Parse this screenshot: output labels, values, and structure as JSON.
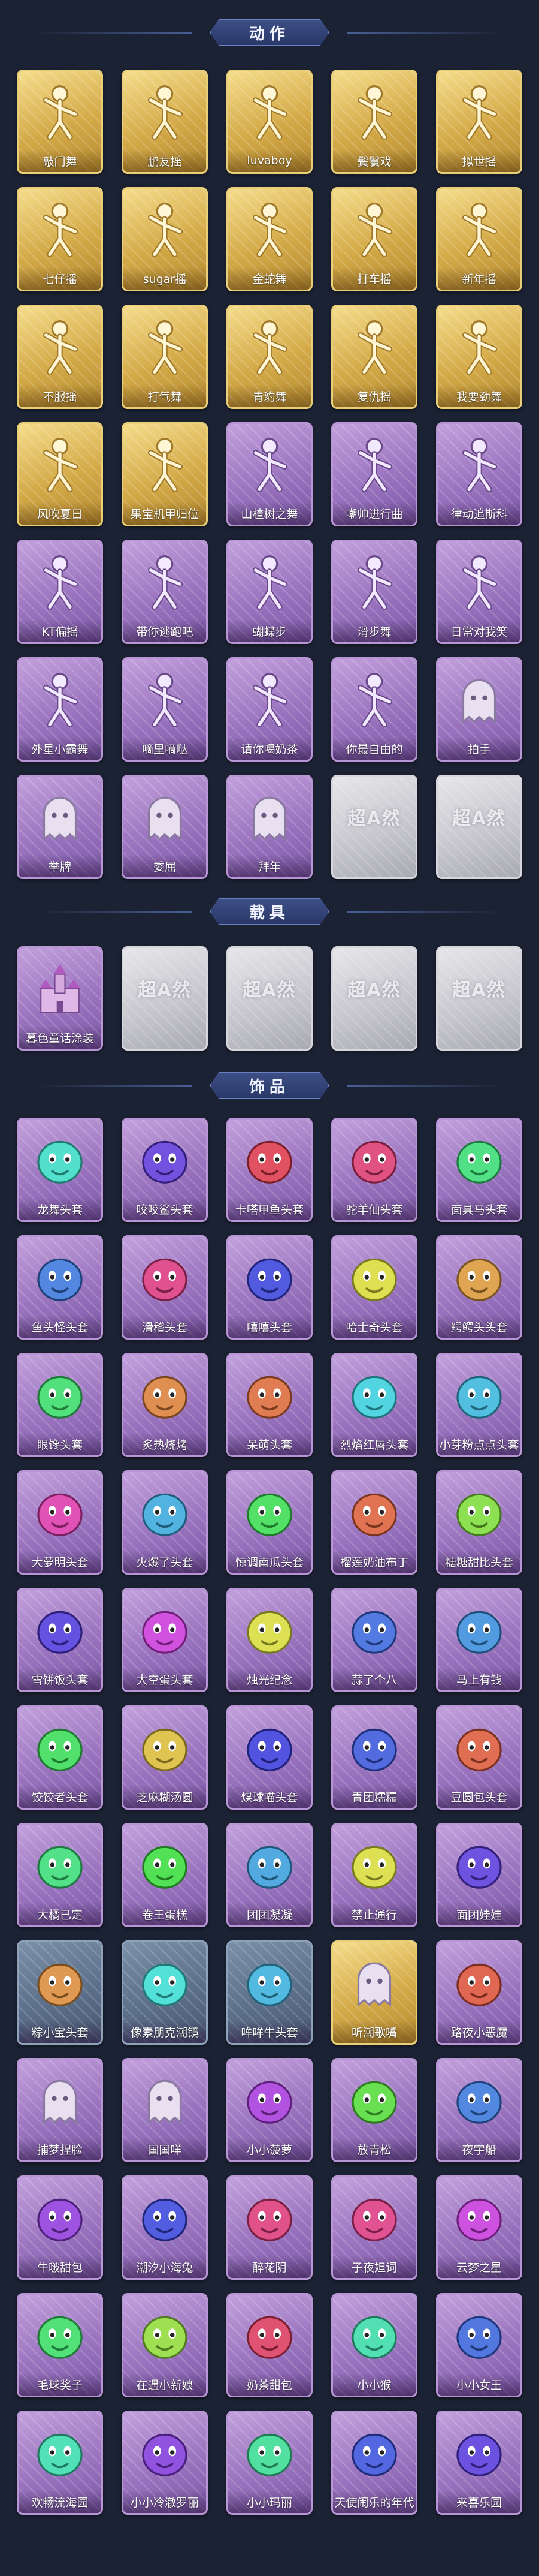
{
  "sections": [
    {
      "id": "actions",
      "title": "动作",
      "items": [
        {
          "label": "敲门舞",
          "style": "gold",
          "icon": "dance-pose-icon"
        },
        {
          "label": "鹏友摇",
          "style": "gold",
          "icon": "dance-pose-icon"
        },
        {
          "label": "luvaboy",
          "style": "gold",
          "icon": "dance-pose-icon"
        },
        {
          "label": "鬓鬟戏",
          "style": "gold",
          "icon": "dance-pose-icon"
        },
        {
          "label": "拟世摇",
          "style": "gold",
          "icon": "dance-pose-icon"
        },
        {
          "label": "七仔摇",
          "style": "gold",
          "icon": "dance-pose-icon"
        },
        {
          "label": "sugar摇",
          "style": "gold",
          "icon": "dance-pose-icon"
        },
        {
          "label": "金蛇舞",
          "style": "gold",
          "icon": "dance-pose-icon"
        },
        {
          "label": "打车摇",
          "style": "gold",
          "icon": "dance-pose-icon"
        },
        {
          "label": "新年摇",
          "style": "gold",
          "icon": "dance-pose-icon"
        },
        {
          "label": "不服摇",
          "style": "gold",
          "icon": "dance-pose-icon"
        },
        {
          "label": "打气舞",
          "style": "gold",
          "icon": "dance-pose-icon"
        },
        {
          "label": "青豹舞",
          "style": "gold",
          "icon": "dance-pose-icon"
        },
        {
          "label": "复仇摇",
          "style": "gold",
          "icon": "dance-pose-icon"
        },
        {
          "label": "我要劲舞",
          "style": "gold",
          "icon": "dance-pose-icon"
        },
        {
          "label": "风吹夏日",
          "style": "gold",
          "icon": "dance-pose-icon"
        },
        {
          "label": "果宝机甲归位",
          "style": "gold",
          "icon": "dance-pose-icon"
        },
        {
          "label": "山楂树之舞",
          "style": "purple",
          "icon": "dance-pose-icon"
        },
        {
          "label": "嘲帅进行曲",
          "style": "purple",
          "icon": "dance-pose-icon"
        },
        {
          "label": "律动追斯科",
          "style": "purple",
          "icon": "dance-pose-icon"
        },
        {
          "label": "KT偏摇",
          "style": "purple",
          "icon": "dance-pose-icon"
        },
        {
          "label": "带你逃跑吧",
          "style": "purple",
          "icon": "dance-pose-icon"
        },
        {
          "label": "蝴蝶步",
          "style": "purple",
          "icon": "dance-pose-icon"
        },
        {
          "label": "滑步舞",
          "style": "purple",
          "icon": "dance-pose-icon"
        },
        {
          "label": "日常对我笑",
          "style": "purple",
          "icon": "dance-pose-icon"
        },
        {
          "label": "外星小霸舞",
          "style": "purple",
          "icon": "dance-pose-icon"
        },
        {
          "label": "嘀里嘀哒",
          "style": "purple",
          "icon": "dance-pose-icon"
        },
        {
          "label": "请你喝奶茶",
          "style": "purple",
          "icon": "dance-pose-icon"
        },
        {
          "label": "你最自由的",
          "style": "purple",
          "icon": "dance-pose-icon"
        },
        {
          "label": "拍手",
          "style": "purple",
          "icon": "ghost-pose-icon"
        },
        {
          "label": "举牌",
          "style": "purple",
          "icon": "ghost-pose-icon"
        },
        {
          "label": "委屈",
          "style": "purple",
          "icon": "ghost-pose-icon"
        },
        {
          "label": "拜年",
          "style": "purple",
          "icon": "ghost-pose-icon"
        },
        {
          "label": "超A然",
          "style": "silver",
          "icon": "brand-placeholder-icon"
        },
        {
          "label": "超A然",
          "style": "silver",
          "icon": "brand-placeholder-icon"
        }
      ]
    },
    {
      "id": "vehicles",
      "title": "载具",
      "items": [
        {
          "label": "暮色童话涂装",
          "style": "purple",
          "icon": "castle-icon"
        },
        {
          "label": "超A然",
          "style": "silver",
          "icon": "brand-placeholder-icon"
        },
        {
          "label": "超A然",
          "style": "silver",
          "icon": "brand-placeholder-icon"
        },
        {
          "label": "超A然",
          "style": "silver",
          "icon": "brand-placeholder-icon"
        },
        {
          "label": "超A然",
          "style": "silver",
          "icon": "brand-placeholder-icon"
        }
      ]
    },
    {
      "id": "accessories",
      "title": "饰品",
      "items": [
        {
          "label": "龙舞头套",
          "style": "purple",
          "icon": "dragon-head-icon"
        },
        {
          "label": "咬咬鲨头套",
          "style": "purple",
          "icon": "shark-head-icon"
        },
        {
          "label": "卡嗒甲鱼头套",
          "style": "purple",
          "icon": "fish-head-icon"
        },
        {
          "label": "驼羊仙头套",
          "style": "purple",
          "icon": "sheep-head-icon"
        },
        {
          "label": "面具马头套",
          "style": "purple",
          "icon": "horse-head-icon"
        },
        {
          "label": "鱼头怪头套",
          "style": "purple",
          "icon": "fish-monster-icon"
        },
        {
          "label": "滑稽头套",
          "style": "purple",
          "icon": "funny-face-icon"
        },
        {
          "label": "嘻嘻头套",
          "style": "purple",
          "icon": "grin-face-icon"
        },
        {
          "label": "哈士奇头套",
          "style": "purple",
          "icon": "dog-head-icon"
        },
        {
          "label": "鳄鳄头头套",
          "style": "purple",
          "icon": "crocodile-head-icon"
        },
        {
          "label": "眼馋头套",
          "style": "purple",
          "icon": "drool-face-icon"
        },
        {
          "label": "炙热烧烤",
          "style": "purple",
          "icon": "bbq-head-icon"
        },
        {
          "label": "呆萌头套",
          "style": "purple",
          "icon": "dumb-face-icon"
        },
        {
          "label": "烈焰红唇头套",
          "style": "purple",
          "icon": "cool-pikachu-icon"
        },
        {
          "label": "小芽粉点点头套",
          "style": "purple",
          "icon": "pink-blob-icon"
        },
        {
          "label": "大萝明头套",
          "style": "purple",
          "icon": "bokchoy-head-icon"
        },
        {
          "label": "火爆了头套",
          "style": "purple",
          "icon": "fire-head-icon"
        },
        {
          "label": "惊调南瓜头套",
          "style": "purple",
          "icon": "pumpkin-head-icon"
        },
        {
          "label": "榴莲奶油布丁",
          "style": "purple",
          "icon": "pudding-head-icon"
        },
        {
          "label": "糖糖甜比头套",
          "style": "purple",
          "icon": "pink-bunny-icon"
        },
        {
          "label": "雪饼饭头套",
          "style": "purple",
          "icon": "snowman-head-icon"
        },
        {
          "label": "大空蛋头套",
          "style": "purple",
          "icon": "egg-head-icon"
        },
        {
          "label": "烛光纪念",
          "style": "purple",
          "icon": "candle-head-icon"
        },
        {
          "label": "蒜了个八",
          "style": "purple",
          "icon": "garlic-head-icon"
        },
        {
          "label": "马上有钱",
          "style": "purple",
          "icon": "money-head-icon"
        },
        {
          "label": "饺饺者头套",
          "style": "purple",
          "icon": "dumpling-head-icon"
        },
        {
          "label": "芝麻糊汤圆",
          "style": "purple",
          "icon": "tangyuan-head-icon"
        },
        {
          "label": "煤球喵头套",
          "style": "purple",
          "icon": "cat-head-icon"
        },
        {
          "label": "青团糯糯",
          "style": "purple",
          "icon": "green-bun-icon"
        },
        {
          "label": "豆圆包头套",
          "style": "purple",
          "icon": "bun-head-icon"
        },
        {
          "label": "大橘已定",
          "style": "purple",
          "icon": "orange-head-icon"
        },
        {
          "label": "卷王蛋糕",
          "style": "purple",
          "icon": "cake-head-icon"
        },
        {
          "label": "团团凝凝",
          "style": "purple",
          "icon": "hamster-head-icon"
        },
        {
          "label": "禁止通行",
          "style": "purple",
          "icon": "roadblock-head-icon"
        },
        {
          "label": "面团娃娃",
          "style": "purple",
          "icon": "dough-head-icon"
        },
        {
          "label": "粽小宝头套",
          "style": "blue",
          "icon": "zongzi-head-icon"
        },
        {
          "label": "像素朋克潮镜",
          "style": "blue",
          "icon": "pixel-sunglasses-icon"
        },
        {
          "label": "哞哞牛头套",
          "style": "blue",
          "icon": "cow-head-icon"
        },
        {
          "label": "听潮歌嘴",
          "style": "gold",
          "icon": "ghost-head-icon"
        },
        {
          "label": "路夜小恶魔",
          "style": "purple",
          "icon": "devil-head-icon"
        },
        {
          "label": "捕梦捏脸",
          "style": "purple",
          "icon": "ghost-head-icon"
        },
        {
          "label": "国国咩",
          "style": "purple",
          "icon": "ghost-head-icon"
        },
        {
          "label": "小小菠萝",
          "style": "purple",
          "icon": "pineapple-doll-icon"
        },
        {
          "label": "放青松",
          "style": "purple",
          "icon": "pine-doll-icon"
        },
        {
          "label": "夜宇船",
          "style": "purple",
          "icon": "crystal-tree-icon"
        },
        {
          "label": "牛啵甜包",
          "style": "purple",
          "icon": "cow-bag-icon"
        },
        {
          "label": "潮汐小海兔",
          "style": "purple",
          "icon": "blue-bunny-icon"
        },
        {
          "label": "醉花阴",
          "style": "purple",
          "icon": "flower-doll-icon"
        },
        {
          "label": "子夜妲词",
          "style": "purple",
          "icon": "dancer-doll-icon"
        },
        {
          "label": "云梦之星",
          "style": "purple",
          "icon": "cloud-star-icon"
        },
        {
          "label": "毛球奖子",
          "style": "purple",
          "icon": "soldier-doll-icon"
        },
        {
          "label": "在遇小新娘",
          "style": "purple",
          "icon": "red-bride-icon"
        },
        {
          "label": "奶茶甜包",
          "style": "purple",
          "icon": "tea-bag-icon"
        },
        {
          "label": "小小猴",
          "style": "purple",
          "icon": "monkey-doll-icon"
        },
        {
          "label": "小小女王",
          "style": "purple",
          "icon": "queen-doll-icon"
        },
        {
          "label": "欢畅流海园",
          "style": "purple",
          "icon": "silver-doll-icon"
        },
        {
          "label": "小小冷澈罗丽",
          "style": "purple",
          "icon": "lolita-doll-icon"
        },
        {
          "label": "小小玛丽",
          "style": "purple",
          "icon": "mary-doll-icon"
        },
        {
          "label": "天使闹乐的年代",
          "style": "purple",
          "icon": "angel-doll-icon"
        },
        {
          "label": "来喜乐园",
          "style": "purple",
          "icon": "fairy-doll-icon"
        }
      ]
    }
  ],
  "colors": {
    "background": "#1b2233",
    "gold": "#d4aa48",
    "purple": "#9a74bf",
    "silver": "#c4c4cb",
    "blue": "#5a6d88"
  }
}
